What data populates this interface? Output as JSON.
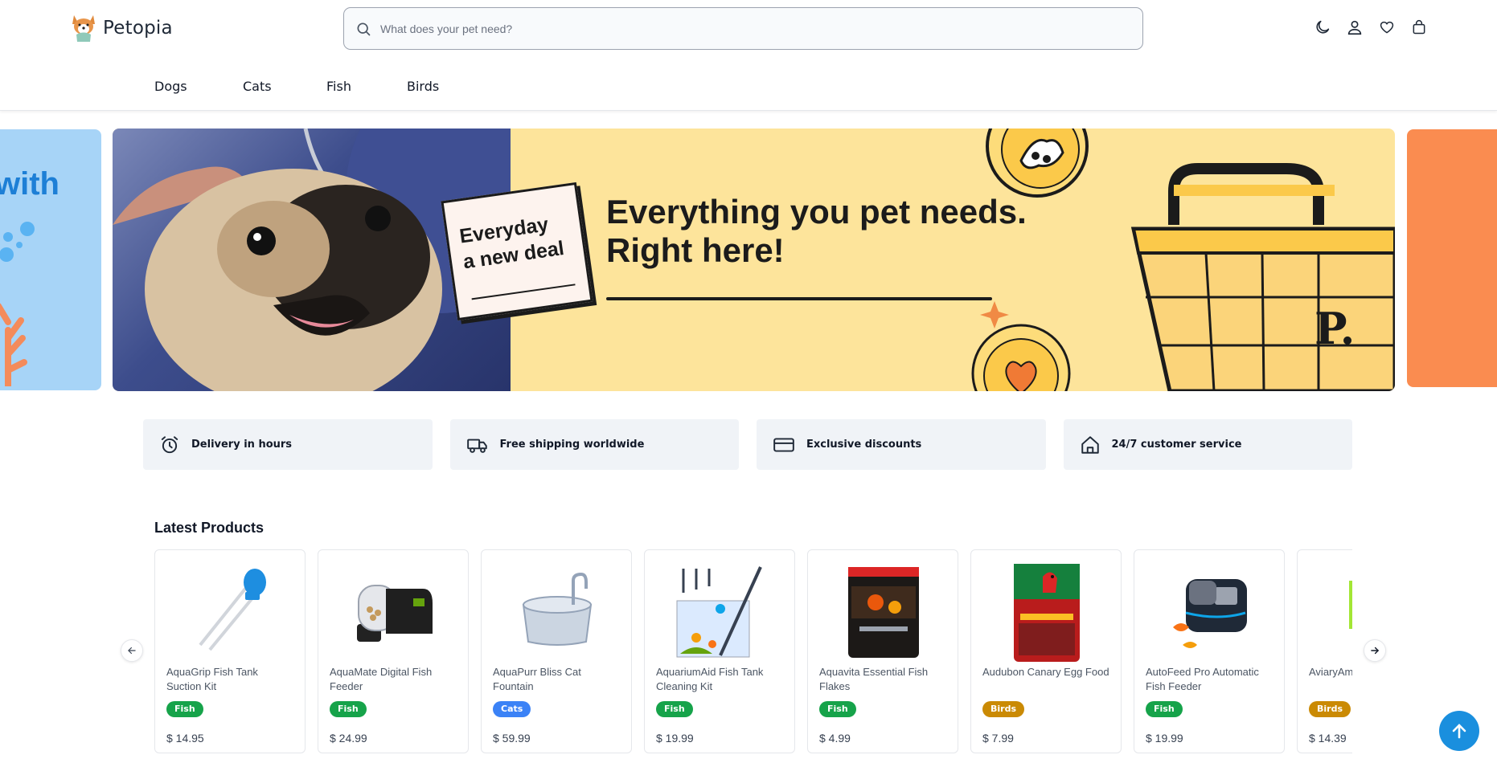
{
  "brand": {
    "name": "Petopia"
  },
  "search": {
    "placeholder": "What does your pet need?"
  },
  "header_icons": [
    "moon-icon",
    "user-icon",
    "heart-icon",
    "bag-icon"
  ],
  "nav": {
    "items": [
      "Dogs",
      "Cats",
      "Fish",
      "Birds"
    ]
  },
  "hero": {
    "prev_slide_text": "with",
    "tag_line1": "Everyday",
    "tag_line2": "a new deal",
    "title_line1": "Everything you pet needs.",
    "title_line2": "Right here!",
    "basket_letter": "P."
  },
  "features": [
    {
      "icon": "alarm-clock-icon",
      "label": "Delivery in hours"
    },
    {
      "icon": "truck-icon",
      "label": "Free shipping worldwide"
    },
    {
      "icon": "credit-card-icon",
      "label": "Exclusive discounts"
    },
    {
      "icon": "house-icon",
      "label": "24/7 customer service"
    }
  ],
  "latest": {
    "title": "Latest Products",
    "products": [
      {
        "name": "AquaGrip Fish Tank Suction Kit",
        "category": "Fish",
        "price": "$ 14.95"
      },
      {
        "name": "AquaMate Digital Fish Feeder",
        "category": "Fish",
        "price": "$ 24.99"
      },
      {
        "name": "AquaPurr Bliss Cat Fountain",
        "category": "Cats",
        "price": "$ 59.99"
      },
      {
        "name": "AquariumAid Fish Tank Cleaning Kit",
        "category": "Fish",
        "price": "$ 19.99"
      },
      {
        "name": "Aquavita Essential Fish Flakes",
        "category": "Fish",
        "price": "$ 4.99"
      },
      {
        "name": "Audubon Canary Egg Food",
        "category": "Birds",
        "price": "$ 7.99"
      },
      {
        "name": "AutoFeed Pro Automatic Fish Feeder",
        "category": "Fish",
        "price": "$ 19.99"
      },
      {
        "name": "AviaryAm",
        "category": "Birds",
        "price": "$ 14.39"
      }
    ]
  },
  "colors": {
    "fish": "#16a34a",
    "cats": "#3b82f6",
    "birds": "#ca8a04",
    "accent": "#1a8fde",
    "hero_bg": "#fde49b"
  }
}
